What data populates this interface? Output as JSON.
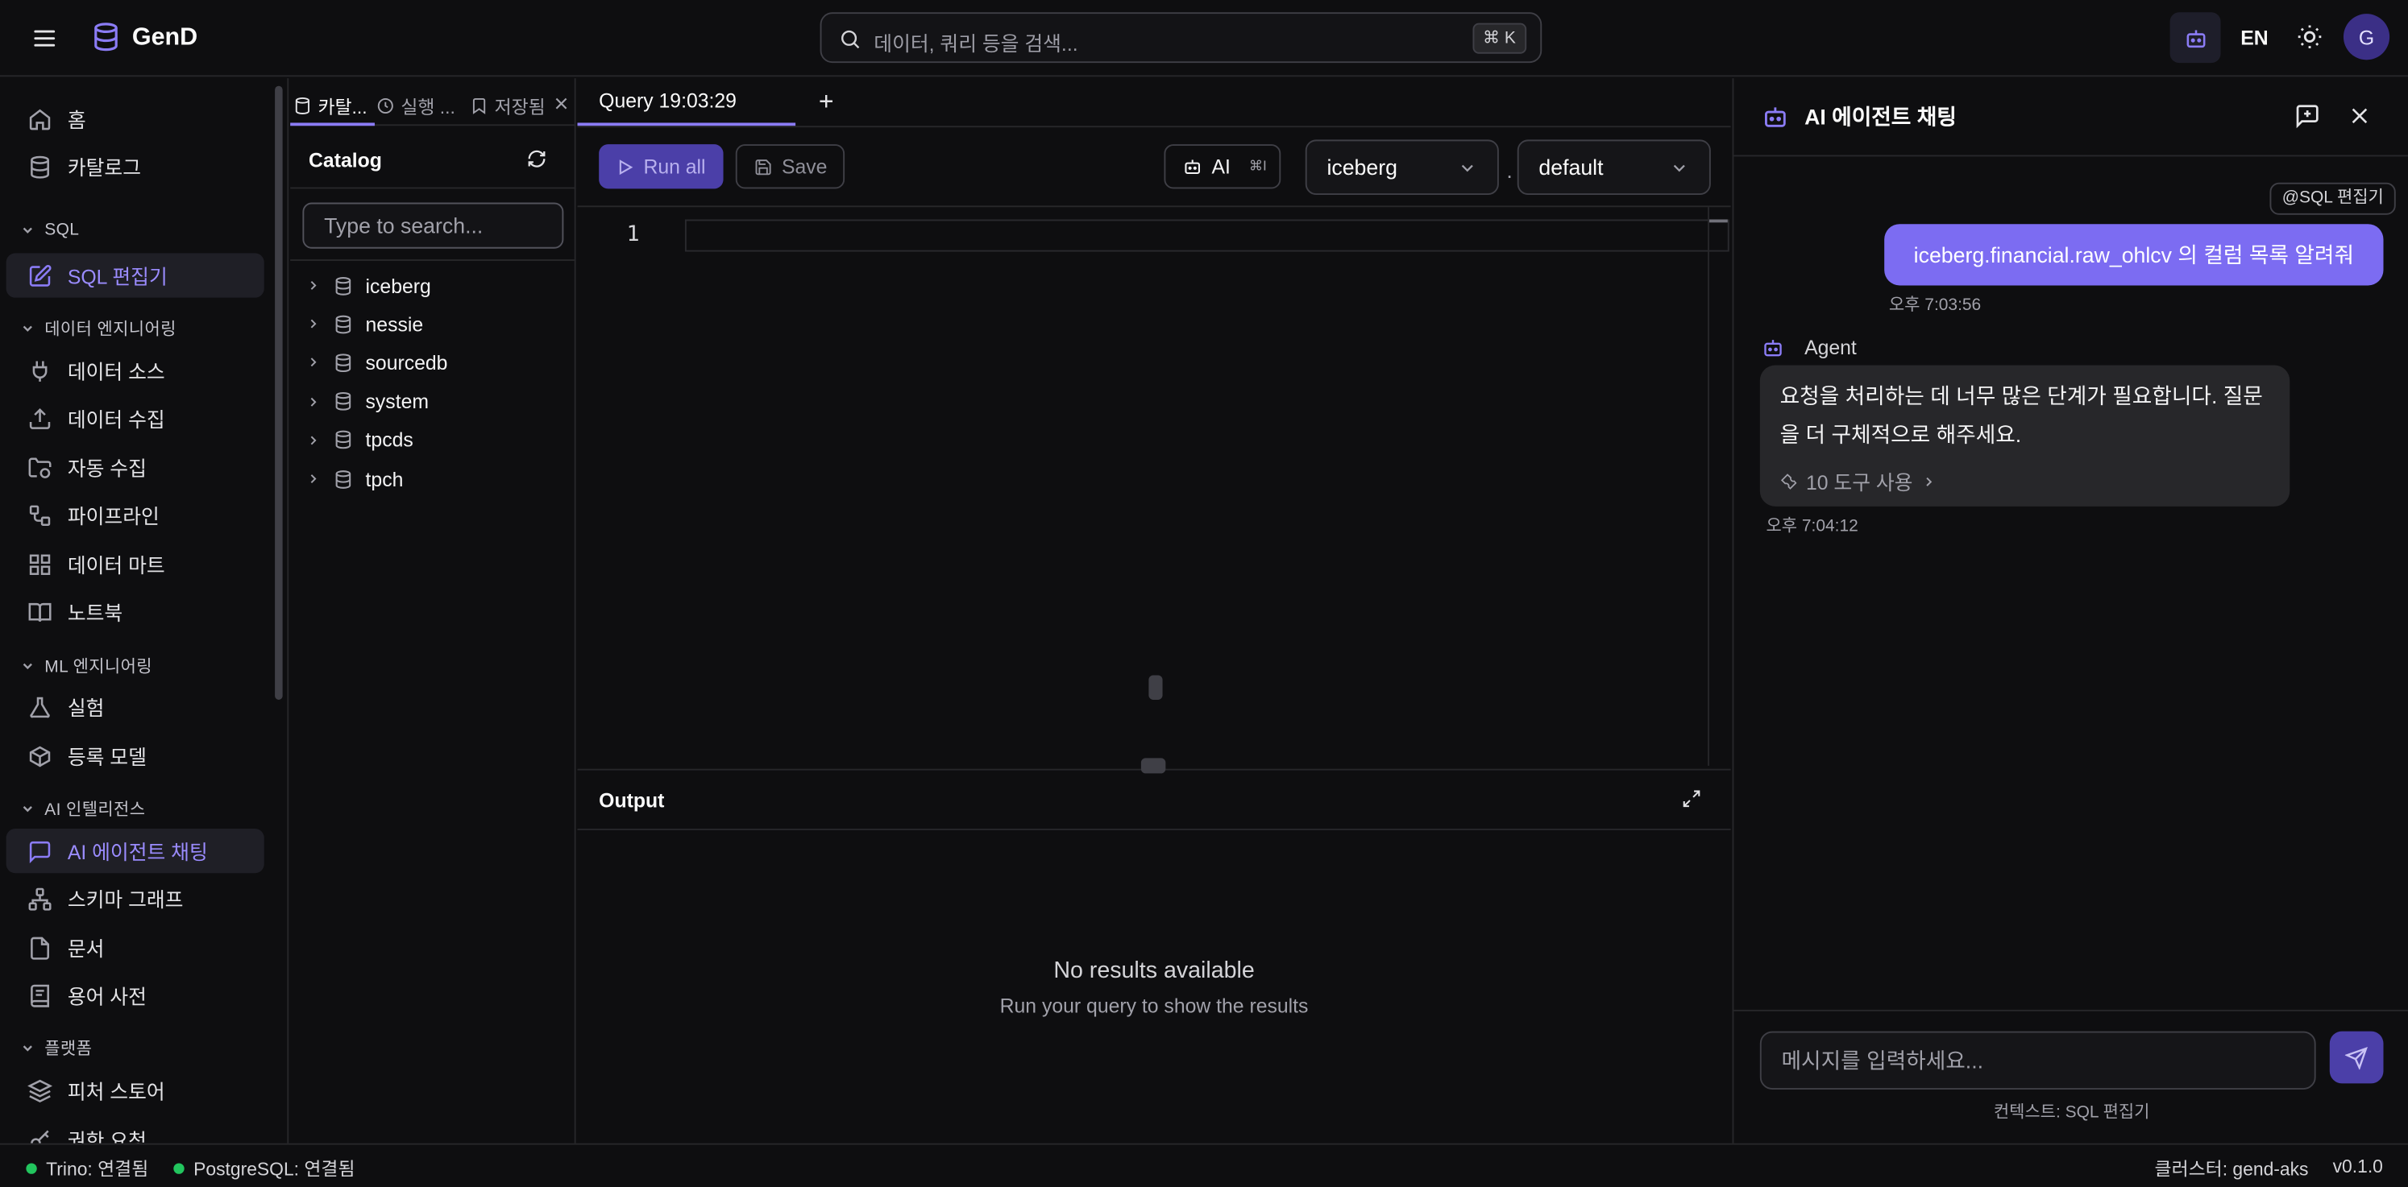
{
  "app": {
    "name": "GenD"
  },
  "header": {
    "search_placeholder": "데이터, 쿼리 등을 검색...",
    "search_shortcut": "⌘ K",
    "lang": "EN",
    "avatar_initial": "G"
  },
  "sidebar": {
    "items": [
      {
        "label": "홈"
      },
      {
        "label": "카탈로그"
      }
    ],
    "sections": [
      {
        "title": "SQL",
        "items": [
          {
            "label": "SQL 편집기",
            "active": true
          }
        ]
      },
      {
        "title": "데이터 엔지니어링",
        "items": [
          {
            "label": "데이터 소스"
          },
          {
            "label": "데이터 수집"
          },
          {
            "label": "자동 수집"
          },
          {
            "label": "파이프라인"
          },
          {
            "label": "데이터 마트"
          },
          {
            "label": "노트북"
          }
        ]
      },
      {
        "title": "ML 엔지니어링",
        "items": [
          {
            "label": "실험"
          },
          {
            "label": "등록 모델"
          }
        ]
      },
      {
        "title": "AI 인텔리전스",
        "items": [
          {
            "label": "AI 에이전트 채팅",
            "active": true
          },
          {
            "label": "스키마 그래프"
          },
          {
            "label": "문서"
          },
          {
            "label": "용어 사전"
          }
        ]
      },
      {
        "title": "플랫폼",
        "items": [
          {
            "label": "피처 스토어"
          },
          {
            "label": "권한 요청"
          }
        ]
      }
    ]
  },
  "catalog_panel": {
    "tabs": [
      {
        "label": "카탈..."
      },
      {
        "label": "실행 ..."
      },
      {
        "label": "저장됨"
      }
    ],
    "title": "Catalog",
    "search_placeholder": "Type to search...",
    "tree": [
      "iceberg",
      "nessie",
      "sourcedb",
      "system",
      "tpcds",
      "tpch"
    ]
  },
  "editor": {
    "tab_label": "Query 19:03:29",
    "run_all": "Run all",
    "save": "Save",
    "ai": "AI",
    "ai_shortcut": "⌘I",
    "catalog_select": "iceberg",
    "separator": ".",
    "schema_select": "default",
    "line_number": "1"
  },
  "output": {
    "title": "Output",
    "empty_title": "No results available",
    "empty_subtitle": "Run your query to show the results"
  },
  "chat": {
    "title": "AI 에이전트 채팅",
    "context_chip": "@SQL 편집기",
    "user_message": "iceberg.financial.raw_ohlcv 의 컬럼 목록 알려줘",
    "user_time": "오후 7:03:56",
    "agent_label": "Agent",
    "agent_message": "요청을 처리하는 데 너무 많은 단계가 필요합니다. 질문을 더 구체적으로 해주세요.",
    "tools_used": "10 도구 사용",
    "agent_time": "오후 7:04:12",
    "input_placeholder": "메시지를 입력하세요...",
    "context_label": "컨텍스트: SQL 편집기"
  },
  "status": {
    "trino": "Trino: 연결됨",
    "postgres": "PostgreSQL: 연결됨",
    "cluster": "클러스터: gend-aks",
    "version": "v0.1.0"
  },
  "colors": {
    "accent": "#8b7cf6",
    "user_bubble": "#7c6cf2",
    "connected": "#22c55e"
  },
  "icons": [
    "menu-icon",
    "database-logo-icon",
    "search-icon",
    "bot-icon",
    "sun-icon",
    "home-icon",
    "database-icon",
    "edit-icon",
    "plug-icon",
    "upload-icon",
    "folder-sync-icon",
    "workflow-icon",
    "grid-icon",
    "book-icon",
    "flask-icon",
    "package-icon",
    "chat-icon",
    "network-icon",
    "file-icon",
    "book-text-icon",
    "layers-icon",
    "clock-icon",
    "bookmark-icon",
    "close-icon",
    "refresh-icon",
    "chevron-right-icon",
    "plus-icon",
    "play-icon",
    "save-icon",
    "chevron-down-icon",
    "expand-icon",
    "new-chat-icon",
    "wrench-icon",
    "send-icon"
  ]
}
